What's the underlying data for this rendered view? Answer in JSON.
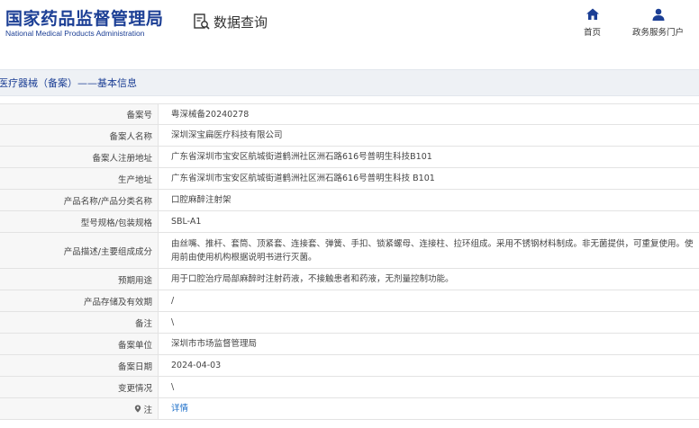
{
  "header": {
    "logo_cn": "国家药品监督管理局",
    "logo_en": "National Medical Products Administration",
    "query_label": "数据查询",
    "nav": [
      {
        "label": "首页",
        "icon": "home-icon"
      },
      {
        "label": "政务服务门户",
        "icon": "user-icon"
      }
    ]
  },
  "breadcrumb": "医疗器械（备案）——基本信息",
  "rows": [
    {
      "label": "备案号",
      "value": "粤深械备20240278"
    },
    {
      "label": "备案人名称",
      "value": "深圳深宝扁医疗科技有限公司"
    },
    {
      "label": "备案人注册地址",
      "value": "广东省深圳市宝安区航城街道鹤洲社区洲石路616号普明生科技B101"
    },
    {
      "label": "生产地址",
      "value": "广东省深圳市宝安区航城街道鹤洲社区洲石路616号普明生科技 B101"
    },
    {
      "label": "产品名称/产品分类名称",
      "value": "口腔麻醉注射架"
    },
    {
      "label": "型号规格/包装规格",
      "value": "SBL-A1"
    },
    {
      "label": "产品描述/主要组成成分",
      "value": "由丝嘴、推杆、套筒、顶紧套、连接套、弹簧、手扣、锁紧螺母、连接柱、拉环组成。采用不锈钢材料制成。非无菌提供，可重复使用。使用前由使用机构根据说明书进行灭菌。"
    },
    {
      "label": "预期用途",
      "value": "用于口腔治疗局部麻醉时注射药液，不接触患者和药液，无剂量控制功能。"
    },
    {
      "label": "产品存储及有效期",
      "value": "/"
    },
    {
      "label": "备注",
      "value": "\\"
    },
    {
      "label": "备案单位",
      "value": "深圳市市场监督管理局"
    },
    {
      "label": "备案日期",
      "value": "2024-04-03"
    },
    {
      "label": "变更情况",
      "value": "\\"
    },
    {
      "label": "注",
      "value": "详情"
    }
  ],
  "colors": {
    "brand": "#1c3f95",
    "link": "#1a6dc8",
    "label_bg": "#f7f7f7",
    "crumb_bg": "#eef1f5"
  }
}
